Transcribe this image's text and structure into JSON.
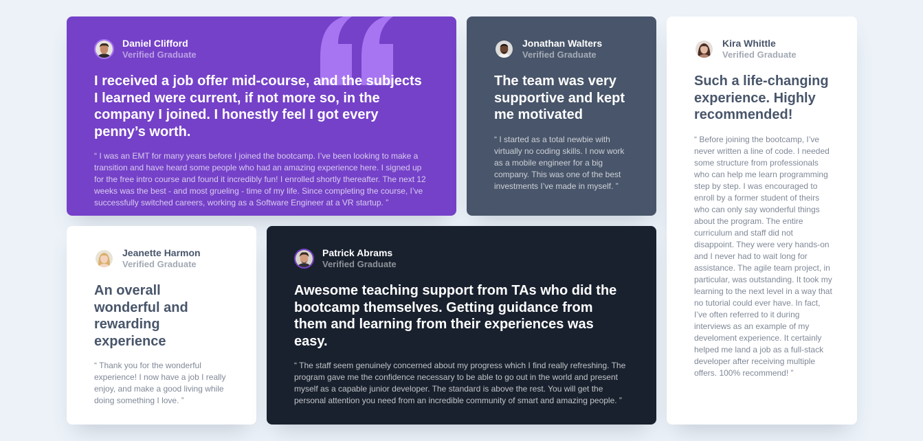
{
  "colors": {
    "page_bg": "#ecf2f8",
    "violet": "#7541c8",
    "grayish_blue": "#48556a",
    "blackish_blue": "#19212e",
    "white": "#ffffff",
    "quote_mark": "#a775f1"
  },
  "testimonials": [
    {
      "name": "Daniel Clifford",
      "status": "Verified Graduate",
      "headline": "I received a job offer mid-course, and the subjects I learned were current, if not more so, in the company I joined. I honestly feel I got every penny’s worth.",
      "body": "“ I was an EMT for many years before I joined the bootcamp. I’ve been looking to make a transition and have heard some people who had an amazing experience here. I signed up for the free intro course and found it incredibly fun! I enrolled shortly thereafter. The next 12 weeks was the best - and most grueling - time of my life. Since completing the course, I’ve successfully switched careers, working as a Software Engineer at a VR startup. ”",
      "avatar_icon": "avatar-daniel-icon"
    },
    {
      "name": "Jonathan Walters",
      "status": "Verified Graduate",
      "headline": "The team was very supportive and kept me motivated",
      "body": "“ I started as a total newbie with virtually no coding skills. I now work as a mobile engineer for a big company. This was one of the best investments I’ve made in myself. ”",
      "avatar_icon": "avatar-jonathan-icon"
    },
    {
      "name": "Kira Whittle",
      "status": "Verified Graduate",
      "headline": "Such a life-changing experience. Highly recommended!",
      "body": "“ Before joining the bootcamp, I’ve never written a line of code. I needed some structure from professionals who can help me learn programming step by step. I was encouraged to enroll by a former student of theirs who can only say wonderful things about the program. The entire curriculum and staff did not disappoint. They were very hands-on and I never had to wait long for assistance. The agile team project, in particular, was outstanding. It took my learning to the next level in a way that no tutorial could ever have. In fact, I’ve often referred to it during interviews as an example of my develoment experience. It certainly helped me land a job as a full-stack developer after receiving multiple offers. 100% recommend! ”",
      "avatar_icon": "avatar-kira-icon"
    },
    {
      "name": "Jeanette Harmon",
      "status": "Verified Graduate",
      "headline": "An overall wonderful and rewarding experience",
      "body": "“ Thank you for the wonderful experience! I now have a job I really enjoy, and make a good living while doing something I love. ”",
      "avatar_icon": "avatar-jeanette-icon"
    },
    {
      "name": "Patrick Abrams",
      "status": "Verified Graduate",
      "headline": "Awesome teaching support from TAs who did the bootcamp themselves. Getting guidance from them and learning from their experiences was easy.",
      "body": "“ The staff seem genuinely concerned about my progress which I find really refreshing. The program gave me the confidence necessary to be able to go out in the world and present myself as a capable junior developer. The standard is above the rest. You will get the personal attention you need from an incredible community of smart and amazing people. ”",
      "avatar_icon": "avatar-patrick-icon"
    }
  ]
}
